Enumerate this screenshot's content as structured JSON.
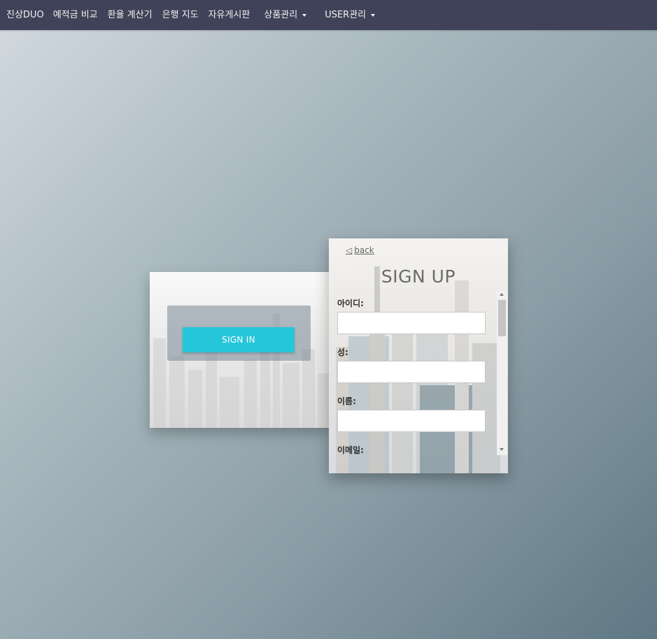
{
  "nav": {
    "brand": "진상DUO",
    "items": [
      "예적금 비교",
      "환율 계산기",
      "은행 지도",
      "자유게시판"
    ],
    "dropdowns": [
      "상품관리",
      "USER관리"
    ]
  },
  "signin": {
    "button_label": "SIGN IN"
  },
  "signup": {
    "back_label": "back",
    "back_icon": "◁",
    "title": "SIGN UP",
    "fields": [
      {
        "label": "아이디:",
        "value": ""
      },
      {
        "label": "성:",
        "value": ""
      },
      {
        "label": "이름:",
        "value": ""
      },
      {
        "label": "이메일:",
        "value": ""
      }
    ]
  },
  "colors": {
    "navbar": "#3f4258",
    "accent": "#26c6da"
  }
}
